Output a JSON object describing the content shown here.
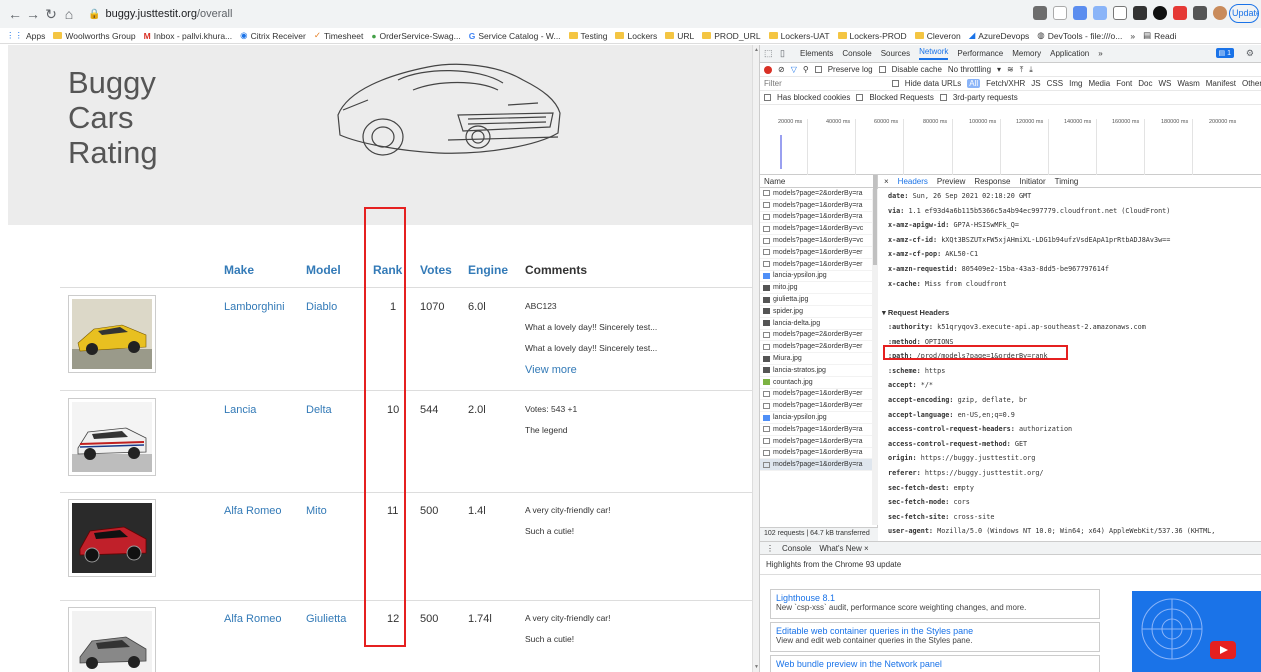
{
  "browser": {
    "url_domain": "buggy.justtestit.org",
    "url_path": "/overall",
    "update_label": "Update"
  },
  "bookmarks": [
    "Apps",
    "Woolworths Group",
    "Inbox - pallvi.khura...",
    "Citrix Receiver",
    "Timesheet",
    "OrderService-Swag...",
    "Service Catalog - W...",
    "Testing",
    "Lockers",
    "URL",
    "PROD_URL",
    "Lockers-UAT",
    "Lockers-PROD",
    "Cleveron",
    "AzureDevops",
    "DevTools - file:///o...",
    "»",
    "Readi"
  ],
  "site": {
    "brand_lines": [
      "Buggy",
      "Cars",
      "Rating"
    ],
    "columns": [
      "Make",
      "Model",
      "Rank",
      "Votes",
      "Engine",
      "Comments"
    ],
    "rows": [
      {
        "make": "Lamborghini",
        "model": "Diablo",
        "rank": "1",
        "votes": "1070",
        "engine": "6.0l",
        "comments": [
          "ABC123",
          "What a lovely day!! Sincerely test...",
          "What a lovely day!! Sincerely test..."
        ],
        "view_more": "View more",
        "car_color": "#e8c020"
      },
      {
        "make": "Lancia",
        "model": "Delta",
        "rank": "10",
        "votes": "544",
        "engine": "2.0l",
        "comments": [
          "Votes: 543 +1",
          "The legend"
        ],
        "car_color": "#f0f0f0"
      },
      {
        "make": "Alfa Romeo",
        "model": "Mito",
        "rank": "11",
        "votes": "500",
        "engine": "1.4l",
        "comments": [
          "A very city-friendly car!",
          "Such a cutie!"
        ],
        "car_color": "#c0202a"
      },
      {
        "make": "Alfa Romeo",
        "model": "Giulietta",
        "rank": "12",
        "votes": "500",
        "engine": "1.74l",
        "comments": [
          "A very city-friendly car!",
          "Such a cutie!"
        ],
        "car_color": "#888888"
      }
    ]
  },
  "devtools": {
    "tabs": [
      "Elements",
      "Console",
      "Sources",
      "Network",
      "Performance",
      "Memory",
      "Application",
      "»"
    ],
    "active_tab": "Network",
    "badge": "1",
    "toolbar": {
      "preserve_log": "Preserve log",
      "disable_cache": "Disable cache",
      "throttling": "No throttling"
    },
    "filter": {
      "placeholder": "Filter",
      "hide_data_urls": "Hide data URLs",
      "types": [
        "All",
        "Fetch/XHR",
        "JS",
        "CSS",
        "Img",
        "Media",
        "Font",
        "Doc",
        "WS",
        "Wasm",
        "Manifest",
        "Other"
      ]
    },
    "filter2": [
      "Has blocked cookies",
      "Blocked Requests",
      "3rd-party requests"
    ],
    "timeline_ticks": [
      "20000 ms",
      "40000 ms",
      "60000 ms",
      "80000 ms",
      "100000 ms",
      "120000 ms",
      "140000 ms",
      "160000 ms",
      "180000 ms",
      "200000 ms"
    ],
    "list_header": "Name",
    "requests": [
      {
        "name": "models?page=2&orderBy=ra",
        "icon": "blank"
      },
      {
        "name": "models?page=1&orderBy=ra",
        "icon": "blank"
      },
      {
        "name": "models?page=1&orderBy=ra",
        "icon": "blank"
      },
      {
        "name": "models?page=1&orderBy=vc",
        "icon": "blank"
      },
      {
        "name": "models?page=1&orderBy=vc",
        "icon": "blank"
      },
      {
        "name": "models?page=1&orderBy=er",
        "icon": "blank"
      },
      {
        "name": "models?page=1&orderBy=er",
        "icon": "blank"
      },
      {
        "name": "lancia-ypsilon.jpg",
        "icon": "doc"
      },
      {
        "name": "mito.jpg",
        "icon": "img"
      },
      {
        "name": "giulietta.jpg",
        "icon": "img"
      },
      {
        "name": "spider.jpg",
        "icon": "img"
      },
      {
        "name": "lancia-delta.jpg",
        "icon": "img"
      },
      {
        "name": "models?page=2&orderBy=er",
        "icon": "blank"
      },
      {
        "name": "models?page=2&orderBy=er",
        "icon": "blank"
      },
      {
        "name": "Miura.jpg",
        "icon": "img"
      },
      {
        "name": "lancia-stratos.jpg",
        "icon": "img"
      },
      {
        "name": "countach.jpg",
        "icon": "grn"
      },
      {
        "name": "models?page=1&orderBy=er",
        "icon": "blank"
      },
      {
        "name": "models?page=1&orderBy=er",
        "icon": "blank"
      },
      {
        "name": "lancia-ypsilon.jpg",
        "icon": "doc"
      },
      {
        "name": "models?page=1&orderBy=ra",
        "icon": "blank"
      },
      {
        "name": "models?page=1&orderBy=ra",
        "icon": "blank"
      },
      {
        "name": "models?page=1&orderBy=ra",
        "icon": "blank"
      },
      {
        "name": "models?page=1&orderBy=ra",
        "icon": "blank"
      }
    ],
    "summary": "102 requests  |  64.7 kB transferred",
    "detail_tabs": [
      "Headers",
      "Preview",
      "Response",
      "Initiator",
      "Timing"
    ],
    "response_headers": [
      {
        "k": "date:",
        "v": "Sun, 26 Sep 2021 02:18:20 GMT"
      },
      {
        "k": "via:",
        "v": "1.1 ef93d4a6b115b5366c5a4b94ec997779.cloudfront.net (CloudFront)"
      },
      {
        "k": "x-amz-apigw-id:",
        "v": "GP7A-HSISwMFk_Q="
      },
      {
        "k": "x-amz-cf-id:",
        "v": "kXQt3BSZUTxFW5xjAHmiXL-LDG1b94ufzVsdEApA1prRtbADJ8Av3w=="
      },
      {
        "k": "x-amz-cf-pop:",
        "v": "AKL50-C1"
      },
      {
        "k": "x-amzn-requestid:",
        "v": "805409e2-15ba-43a3-8dd5-be967797614f"
      },
      {
        "k": "x-cache:",
        "v": "Miss from cloudfront"
      }
    ],
    "request_headers_title": "▾ Request Headers",
    "request_headers": [
      {
        "k": ":authority:",
        "v": "k51qryqov3.execute-api.ap-southeast-2.amazonaws.com"
      },
      {
        "k": ":method:",
        "v": "OPTIONS"
      },
      {
        "k": ":path:",
        "v": "/prod/models?page=1&orderBy=rank"
      },
      {
        "k": ":scheme:",
        "v": "https"
      },
      {
        "k": "accept:",
        "v": "*/*"
      },
      {
        "k": "accept-encoding:",
        "v": "gzip, deflate, br"
      },
      {
        "k": "accept-language:",
        "v": "en-US,en;q=0.9"
      },
      {
        "k": "access-control-request-headers:",
        "v": "authorization"
      },
      {
        "k": "access-control-request-method:",
        "v": "GET"
      },
      {
        "k": "origin:",
        "v": "https://buggy.justtestit.org"
      },
      {
        "k": "referer:",
        "v": "https://buggy.justtestit.org/"
      },
      {
        "k": "sec-fetch-dest:",
        "v": "empty"
      },
      {
        "k": "sec-fetch-mode:",
        "v": "cors"
      },
      {
        "k": "sec-fetch-site:",
        "v": "cross-site"
      },
      {
        "k": "user-agent:",
        "v": "Mozilla/5.0 (Windows NT 10.0; Win64; x64) AppleWebKit/537.36 (KHTML,"
      }
    ],
    "drawer_tabs": [
      "Console",
      "What's New ×"
    ],
    "drawer_subtitle": "Highlights from the Chrome 93 update",
    "whats_new": [
      {
        "title": "Lighthouse 8.1",
        "desc": "New `csp-xss` audit, performance score weighting changes, and more."
      },
      {
        "title": "Editable web container queries in the Styles pane",
        "desc": "View and edit web container queries in the Styles pane."
      },
      {
        "title": "Web bundle preview in the Network panel",
        "desc": ""
      }
    ]
  }
}
